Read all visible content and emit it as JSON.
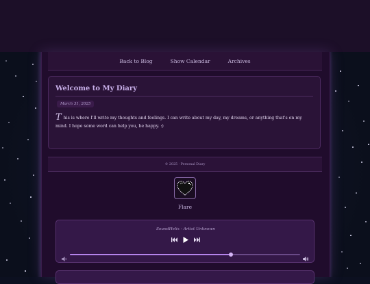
{
  "nav": {
    "items": [
      "Back to Blog",
      "Show Calendar",
      "Archives"
    ]
  },
  "post": {
    "title": "Welcome to My Diary",
    "date": "March 31, 2025",
    "dropcap": "T",
    "body": "his is where I'll write my thoughts and feelings. I can write about my day, my dreams, or anything that's on my mind. I hope some word can help you, be happy. :)"
  },
  "footer": {
    "text": "© 2025 · Personal Diary"
  },
  "profile": {
    "name": "Flare",
    "avatar_icon": "black-heart-icon"
  },
  "player": {
    "track": "SoundHelix - Artist Unknown",
    "controls": [
      "previous-track-icon",
      "play-icon",
      "next-track-icon"
    ],
    "volume_level": 0.7
  },
  "colors": {
    "accent": "#b584ec",
    "panel": "#2a1337",
    "page_background": "#200c2c"
  }
}
